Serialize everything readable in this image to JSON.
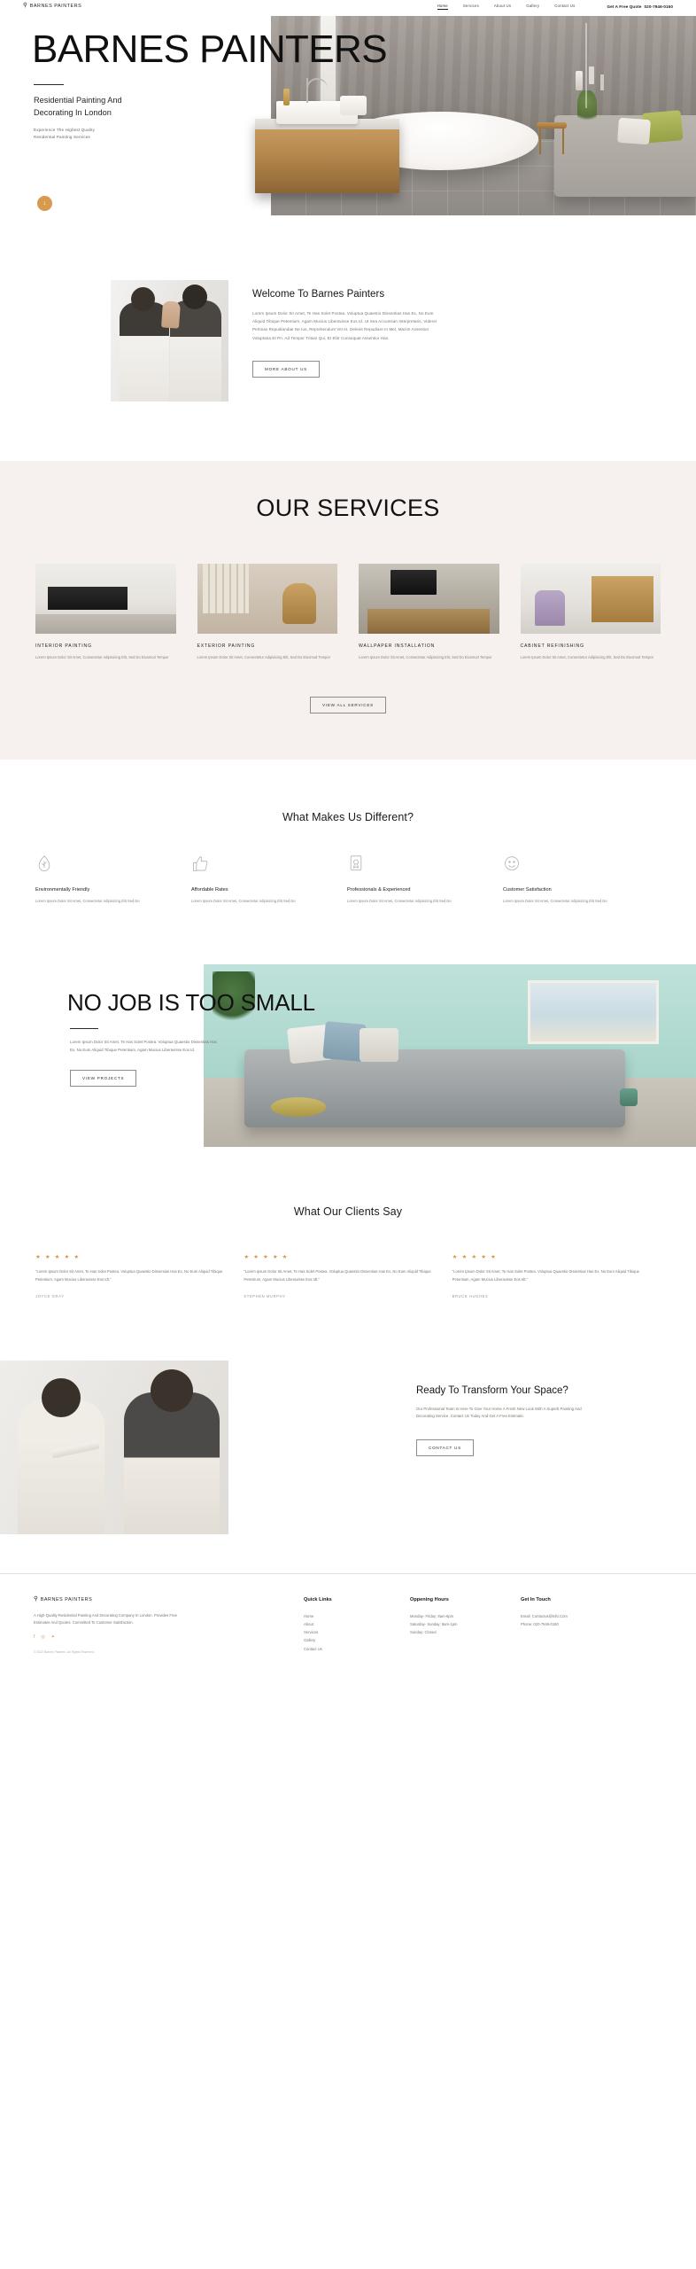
{
  "header": {
    "brand_mark": "⚲",
    "brand_name": "BARNES PAINTERS",
    "nav": [
      {
        "label": "Home",
        "active": true
      },
      {
        "label": "Services",
        "active": false
      },
      {
        "label": "About Us",
        "active": false
      },
      {
        "label": "Gallery",
        "active": false
      },
      {
        "label": "Contact Us",
        "active": false
      }
    ],
    "quote_label": "Get A Free Quote",
    "quote_phone": "020-7946-0160"
  },
  "hero": {
    "title": "BARNES PAINTERS",
    "subtitle_line1": "Residential Painting And",
    "subtitle_line2": "Decorating In London",
    "kicker_line1": "Experience The Highest Quality",
    "kicker_line2": "Residential Painting Services",
    "scroll_indicator": "↓"
  },
  "welcome": {
    "heading": "Welcome To Barnes Painters",
    "body": "Lorem Ipsum Dolor Sit Amet, Te Has Solet Postea. Voluptua Quaestio Dissentias Has Ex, No Eum Aliquid Tibique Petentium, Agam Mucius Liberavisse Eos Id. Ut Sea Accumsan Interpretaris, Viderer Pertinax Repudiandae Ne Ius, Reprehendunt Vel At. Delenit Repudiare In Mel, Mazim Assentior Voluptaria Et Pri. Ad Tempor Tritani Qui, Et Elitr Consequat Assentior Has.",
    "button": "MORE ABOUT US"
  },
  "services": {
    "heading": "OUR SERVICES",
    "items": [
      {
        "title": "INTERIOR PAINTING",
        "desc": "Lorem Ipsum Dolor Sit Amet, Consectetur Adipisicing Elit, Sed Do Eiusmod Tempor"
      },
      {
        "title": "EXTERIOR PAINTING",
        "desc": "Lorem Ipsum Dolor Sit Amet, Consectetur Adipisicing Elit, Sed Do Eiusmod Tempor"
      },
      {
        "title": "WALLPAPER INSTALLATION",
        "desc": "Lorem Ipsum Dolor Sit Amet, Consectetur Adipisicing Elit, Sed Do Eiusmod Tempor"
      },
      {
        "title": "CABINET REFINISHING",
        "desc": "Lorem Ipsum Dolor Sit Amet, Consectetur Adipisicing Elit, Sed Do Eiusmod Tempor"
      }
    ],
    "button": "VIEW ALL SERVICES"
  },
  "different": {
    "heading": "What Makes Us Different?",
    "items": [
      {
        "icon": "leaf-icon",
        "title": "Environmentally Friendly",
        "desc": "Lorem Ipsum Dolor Sit Amet, Consectetur Adipisicing Elit Sed Do"
      },
      {
        "icon": "thumbs-up-icon",
        "title": "Affordable Rates",
        "desc": "Lorem Ipsum Dolor Sit Amet, Consectetur Adipisicing Elit Sed Do"
      },
      {
        "icon": "certificate-icon",
        "title": "Professionals  & Experienced",
        "desc": "Lorem Ipsum Dolor Sit Amet, Consectetur Adipisicing Elit Sed Do"
      },
      {
        "icon": "smiley-icon",
        "title": "Customer Satisfaction",
        "desc": "Lorem Ipsum Dolor Sit Amet, Consectetur Adipisicing Elit Sed Do"
      }
    ]
  },
  "nojob": {
    "title": "NO JOB IS TOO SMALL",
    "body": "Lorem Ipsum Dolor Sit Amet, Te Has Solet Postea. Voluptua Quaestio Dissentias Has Ex, No Eum Aliquid Tibique Petentium, Agam Mucius Liberavisse Eos Id.",
    "button": "VIEW PROJECTS"
  },
  "testimonials": {
    "heading": "What Our Clients Say",
    "items": [
      {
        "stars": "★ ★ ★ ★ ★",
        "quote": "\"Lorem Ipsum Dolor Sit Amet, Te Has Solet Postea. Voluptua Quaestio Dissentias Has Ex, No Eum Aliquid Tibique Petentium, Agam Mucius Liberavisse Eos Idt.\"",
        "author": "JOYCE GRAY"
      },
      {
        "stars": "★ ★ ★ ★ ★",
        "quote": "\"Lorem Ipsum Dolor Sit Amet, Te Has Solet Postea. Voluptua Quaestio Dissentias Has Ex, No Eum Aliquid Tibique Petentium, Agam Mucius Liberavisse Eos Idt.\"",
        "author": "STEPHEN MURPHY"
      },
      {
        "stars": "★ ★ ★ ★ ★",
        "quote": "\"Lorem Ipsum Dolor Sit Amet, Te Has Solet Postea. Voluptua Quaestio Dissentias Has Ex, No Eum Aliquid Tibique Petentium, Agam Mucius Liberavisse Eos Idt.\"",
        "author": "BRUCE HUGHES"
      }
    ]
  },
  "cta": {
    "title": "Ready To Transform Your Space?",
    "body": "Our Professional Team Is Here To Give Your Home A Fresh New Look With A Superb Painting And Decorating Service. Contact Us Today And Get A Free Estimate.",
    "button": "CONTACT US"
  },
  "footer": {
    "brand_mark": "⚲",
    "brand_name": "BARNES PAINTERS",
    "about": "A High-Quality Residential Painting And Decorating Company In London. Provides Free Estimates And Quotes. Committed To Customer Satisfaction.",
    "social": [
      "f",
      "◎",
      "✦"
    ],
    "copyright": "© 2022 Barnes Painters. All Rights Reserved.",
    "quick_links_heading": "Quick Links",
    "quick_links": [
      "Home",
      "About",
      "Services",
      "Gallery",
      "Contact Us"
    ],
    "hours_heading": "Oppening Hours",
    "hours": [
      "Monday- Friday: 8am-6pm",
      "Saturday- Sunday: 8am-1pm",
      "Sunday: Closed"
    ],
    "touch_heading": "Get In Touch",
    "touch": [
      "Email: Contactus@Info.Com",
      "Phone: 020-7946-0160"
    ]
  },
  "colors": {
    "accent": "#d79a4e",
    "text": "#1c1c1c",
    "muted": "#7d786f",
    "services_bg": "#f6f1ef"
  }
}
